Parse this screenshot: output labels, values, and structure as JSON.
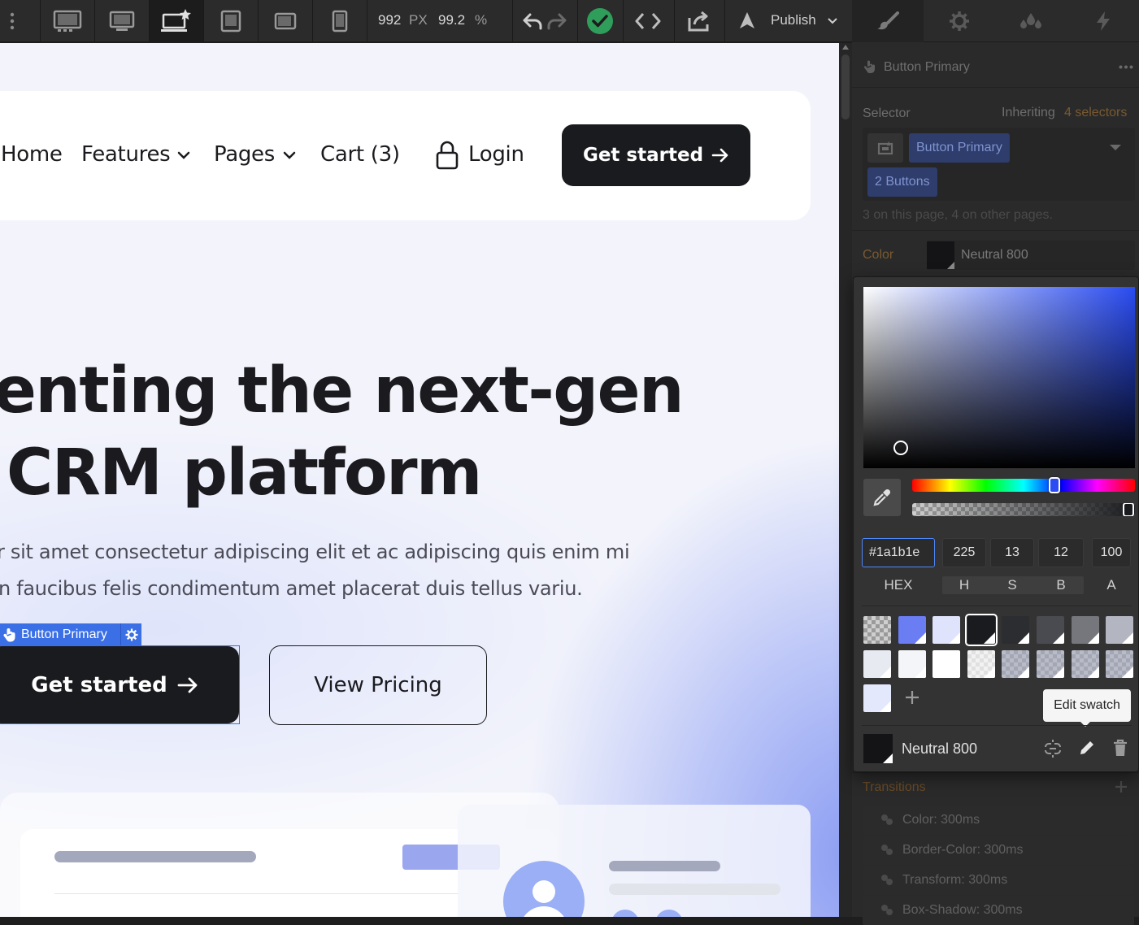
{
  "toolbar": {
    "width_px": "992",
    "width_unit": "PX",
    "zoom": "99.2",
    "zoom_unit": "%",
    "publish_label": "Publish",
    "devices": [
      "desktop-large-icon",
      "desktop-icon",
      "laptop-base-icon",
      "tablet-icon",
      "mobile-landscape-icon",
      "mobile-portrait-icon"
    ]
  },
  "site": {
    "nav": {
      "home": "Home",
      "features": "Features",
      "pages": "Pages",
      "cart": "Cart (3)",
      "login": "Login",
      "cta": "Get started"
    },
    "hero": {
      "title_line1": "enting the next-gen",
      "title_line2": "CRM platform",
      "para_line1": "r sit amet consectetur adipiscing elit et ac adipiscing quis enim mi",
      "para_line2": "n faucibus felis condimentum amet placerat duis tellus variu.",
      "primary_cta": "Get started",
      "secondary_cta": "View Pricing"
    },
    "selection_badge": "Button Primary"
  },
  "panel": {
    "element_name": "Button Primary",
    "selector_label": "Selector",
    "inheriting_prefix": "Inheriting",
    "inheriting_count": "4 selectors",
    "selector_chip_1": "Button Primary",
    "selector_chip_2": "2 Buttons",
    "usage_note": "3 on this page, 4 on other pages.",
    "color_label": "Color",
    "color_value": "Neutral 800",
    "transitions_label": "Transitions",
    "transitions": [
      "Color: 300ms",
      "Border-Color: 300ms",
      "Transform: 300ms",
      "Box-Shadow: 300ms"
    ]
  },
  "picker": {
    "hex": "#1a1b1e",
    "h": "225",
    "s": "13",
    "b": "12",
    "a": "100",
    "labels": {
      "hex": "HEX",
      "h": "H",
      "s": "S",
      "b": "B",
      "a": "A"
    },
    "tooltip": "Edit swatch",
    "swatch_name": "Neutral 800",
    "hue_position": 0.64,
    "alpha_position": 1.0,
    "swatches_row1": [
      "transparent",
      "#6a7df2",
      "#dfe3fb",
      "#1a1b1e",
      "#2c2d31",
      "#4a4b50",
      "#76777c",
      "#b3b6c0"
    ],
    "swatches_row2": [
      "#e8eaf2",
      "#f4f5f8",
      "#ffffff",
      "transparent-light",
      "transparent-mid",
      "transparent-mid",
      "transparent-mid",
      "transparent-mid"
    ],
    "swatches_row3": [
      "#e4e8fd"
    ]
  }
}
